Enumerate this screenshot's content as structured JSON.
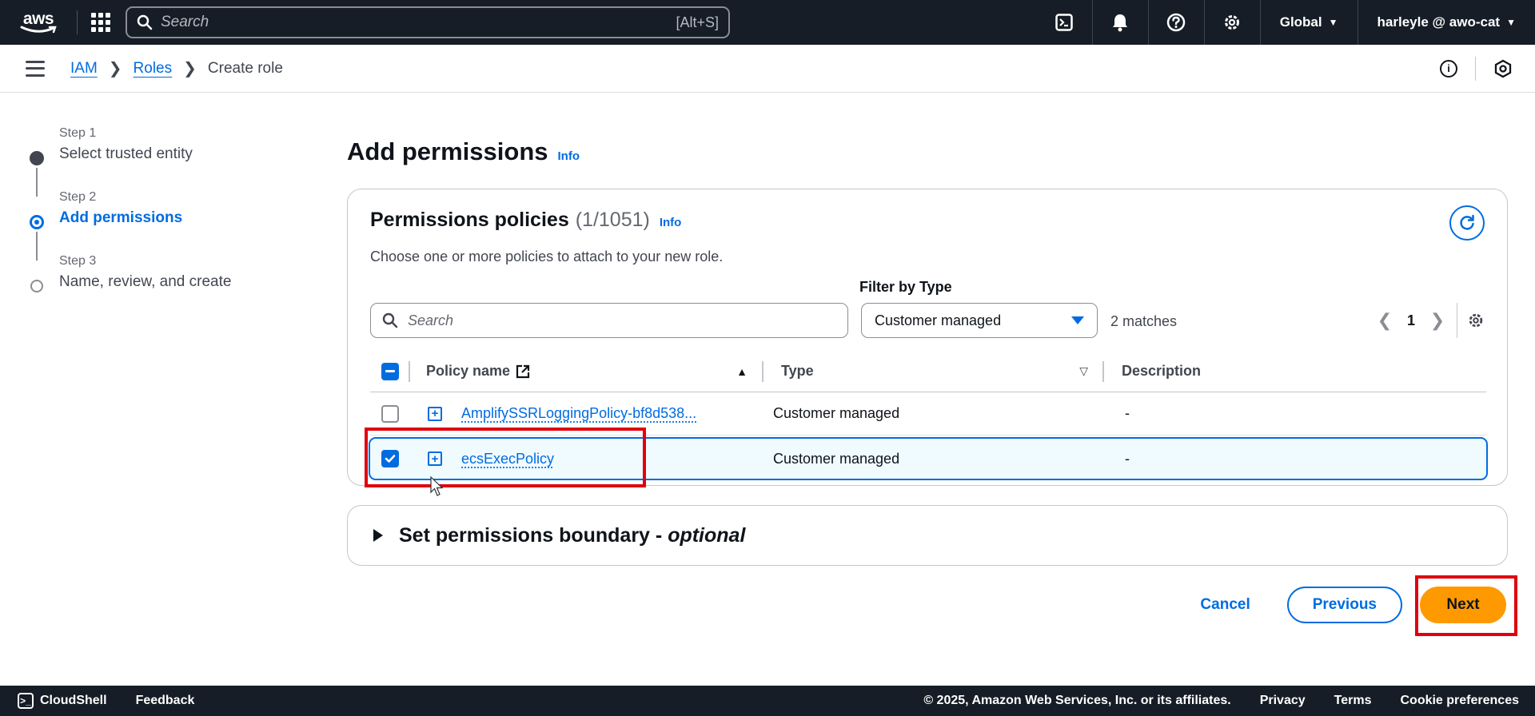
{
  "topnav": {
    "logo_text": "aws",
    "search_placeholder": "Search",
    "search_shortcut": "[Alt+S]",
    "region": "Global",
    "account": "harleyle @ awo-cat",
    "icons": [
      "cloudshell-icon",
      "bell-icon",
      "help-icon",
      "gear-icon"
    ]
  },
  "breadcrumb": {
    "items": [
      "IAM",
      "Roles"
    ],
    "current": "Create role"
  },
  "steps": [
    {
      "number": "Step 1",
      "label": "Select trusted entity",
      "state": "done"
    },
    {
      "number": "Step 2",
      "label": "Add permissions",
      "state": "active"
    },
    {
      "number": "Step 3",
      "label": "Name, review, and create",
      "state": "todo"
    }
  ],
  "page": {
    "title": "Add permissions",
    "info": "Info"
  },
  "policies": {
    "title": "Permissions policies",
    "count": "(1/1051)",
    "info": "Info",
    "description": "Choose one or more policies to attach to your new role.",
    "filter_label": "Filter by Type",
    "search_placeholder": "Search",
    "filter_value": "Customer managed",
    "matches": "2 matches",
    "page": "1",
    "columns": {
      "name": "Policy name",
      "type": "Type",
      "description": "Description"
    },
    "rows": [
      {
        "name": "AmplifySSRLoggingPolicy-bf8d538...",
        "type": "Customer managed",
        "description": "-",
        "checked": false
      },
      {
        "name": "ecsExecPolicy",
        "type": "Customer managed",
        "description": "-",
        "checked": true
      }
    ]
  },
  "boundary": {
    "title": "Set permissions boundary - ",
    "optional": "optional"
  },
  "actions": {
    "cancel": "Cancel",
    "previous": "Previous",
    "next": "Next"
  },
  "footer": {
    "cloudshell": "CloudShell",
    "feedback": "Feedback",
    "copyright": "© 2025, Amazon Web Services, Inc. or its affiliates.",
    "privacy": "Privacy",
    "terms": "Terms",
    "cookies": "Cookie preferences"
  },
  "colors": {
    "nav_bg": "#161d26",
    "accent": "#006ce0",
    "primary_button": "#ff9900",
    "highlight": "#e0000f"
  }
}
